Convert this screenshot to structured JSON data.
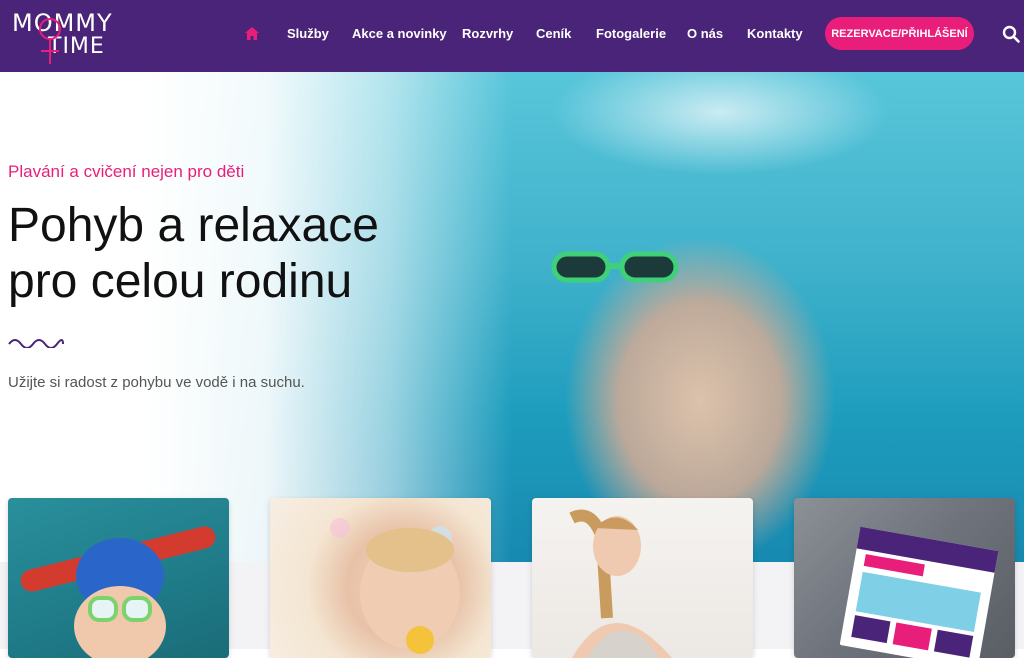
{
  "brand": {
    "line1": "MOMMY",
    "line2": "TIME"
  },
  "nav": {
    "items": [
      "Služby",
      "Akce a novinky",
      "Rozvrhy",
      "Ceník",
      "Fotogalerie",
      "O nás",
      "Kontakty"
    ],
    "cta_label": "REZERVACE/PŘIHLÁŠENÍ"
  },
  "hero": {
    "subtitle": "Plavání a cvičení nejen pro děti",
    "title": "Pohyb a relaxace pro celou rodinu",
    "text": "Užijte si radost z pohybu ve vodě i na suchu."
  },
  "colors": {
    "nav_bg": "#4a2478",
    "accent": "#e91e7a",
    "text": "#111111"
  },
  "icons": {
    "home": "home-icon",
    "search": "search-icon"
  }
}
